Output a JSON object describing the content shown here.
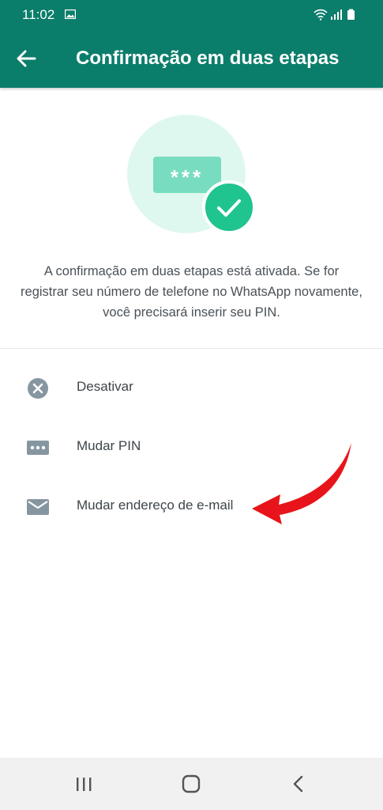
{
  "status": {
    "time": "11:02",
    "icons": [
      "gallery-icon",
      "wifi-icon",
      "signal-icon",
      "battery-icon"
    ]
  },
  "header": {
    "title": "Confirmação em duas etapas",
    "back_icon": "back-arrow-icon"
  },
  "hero": {
    "pin_mask": "***",
    "check_icon": "check-icon"
  },
  "description": "A confirmação em duas etapas está ativada. Se for registrar seu número de telefone no WhatsApp novamente, você precisará inserir seu PIN.",
  "menu": [
    {
      "label": "Desativar",
      "icon": "close-circle-icon"
    },
    {
      "label": "Mudar PIN",
      "icon": "pin-dots-icon"
    },
    {
      "label": "Mudar endereço de e-mail",
      "icon": "email-icon"
    }
  ],
  "annotation": {
    "icon": "red-arrow-annotation",
    "color": "#e8141b"
  },
  "navbar": {
    "icons": [
      "recent-apps-icon",
      "home-icon",
      "back-icon"
    ]
  },
  "colors": {
    "brand": "#0b7d6b",
    "accent": "#1fc48f",
    "hero_bg": "#dff8ef",
    "icon": "#8696a0"
  }
}
